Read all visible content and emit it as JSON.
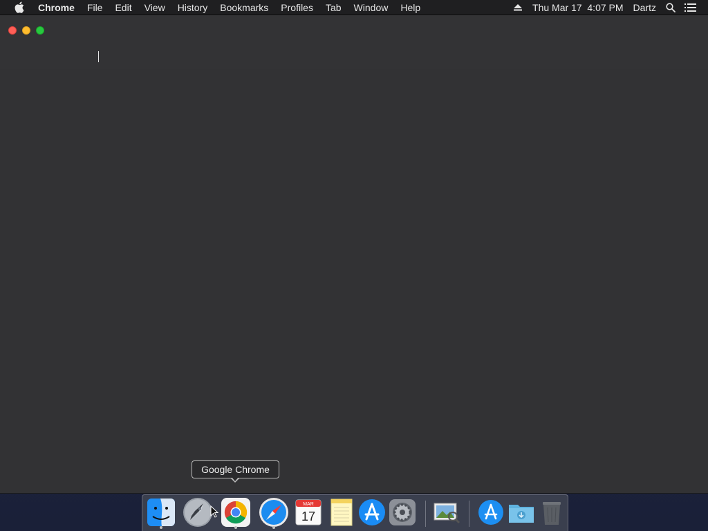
{
  "menubar": {
    "app_name": "Chrome",
    "items": [
      "File",
      "Edit",
      "View",
      "History",
      "Bookmarks",
      "Profiles",
      "Tab",
      "Window",
      "Help"
    ],
    "datetime": "Thu Mar 17  4:07 PM",
    "user": "Dartz"
  },
  "tooltip": {
    "text": "Google Chrome"
  },
  "dock": {
    "items": [
      {
        "name": "Finder",
        "running": true
      },
      {
        "name": "Launchpad",
        "running": false
      },
      {
        "name": "Google Chrome",
        "running": true
      },
      {
        "name": "Safari",
        "running": true
      },
      {
        "name": "Calendar",
        "running": false,
        "month": "MAR",
        "day": "17"
      },
      {
        "name": "Notes",
        "running": false
      },
      {
        "name": "App Store",
        "running": false
      },
      {
        "name": "System Preferences",
        "running": false
      },
      {
        "name": "Preview",
        "running": false
      },
      {
        "name": "Applications",
        "running": false
      },
      {
        "name": "Downloads",
        "running": false
      },
      {
        "name": "Trash",
        "running": false
      }
    ]
  },
  "colors": {
    "close": "#ff5f57",
    "minimize": "#febc2e",
    "maximize": "#28c840",
    "window_bg": "#323234"
  }
}
